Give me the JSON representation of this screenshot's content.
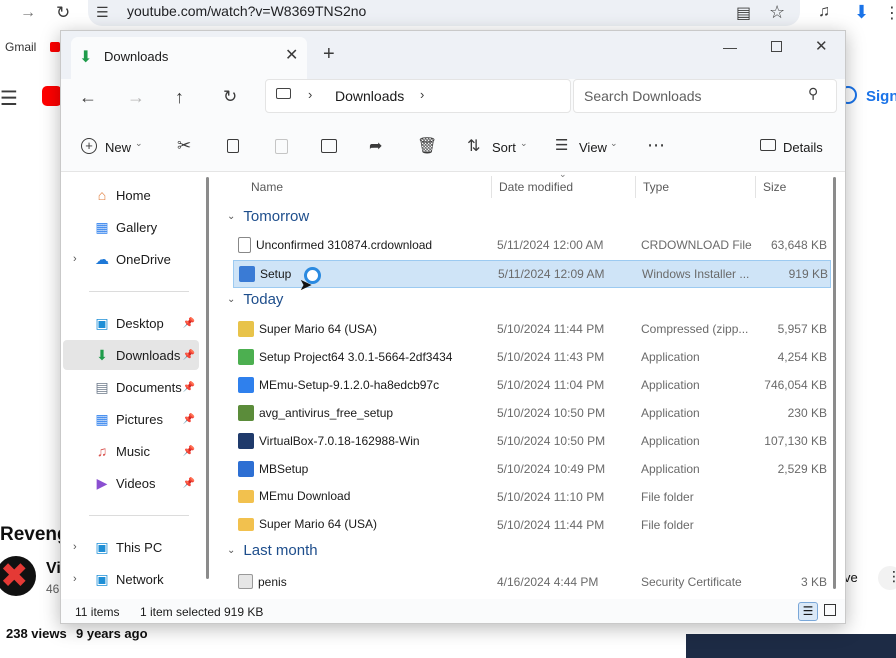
{
  "browser": {
    "url": "youtube.com/watch?v=W8369TNS2no",
    "bookmark_gmail": "Gmail",
    "sign_in": "Sign",
    "video_title_fragment": "Reveng",
    "channel_fragment": "Vi",
    "subs_fragment": "46",
    "views": "238 views",
    "age": "9 years ago",
    "save_fragment": "ve"
  },
  "explorer": {
    "tab_title": "Downloads",
    "address_crumb": "Downloads",
    "search_placeholder": "Search Downloads",
    "toolbar": {
      "new": "New",
      "sort": "Sort",
      "view": "View",
      "details": "Details"
    },
    "sidebar": [
      {
        "label": "Home",
        "icon": "home-icon"
      },
      {
        "label": "Gallery",
        "icon": "gallery-icon"
      },
      {
        "label": "OneDrive",
        "icon": "cloud-icon"
      },
      {
        "label": "Desktop",
        "icon": "desktop-icon"
      },
      {
        "label": "Downloads",
        "icon": "download-icon"
      },
      {
        "label": "Documents",
        "icon": "documents-icon"
      },
      {
        "label": "Pictures",
        "icon": "pictures-icon"
      },
      {
        "label": "Music",
        "icon": "music-icon"
      },
      {
        "label": "Videos",
        "icon": "videos-icon"
      },
      {
        "label": "This PC",
        "icon": "pc-icon"
      },
      {
        "label": "Network",
        "icon": "network-icon"
      }
    ],
    "columns": {
      "name": "Name",
      "date": "Date modified",
      "type": "Type",
      "size": "Size"
    },
    "groups": {
      "tomorrow": "Tomorrow",
      "today": "Today",
      "last_month": "Last month"
    },
    "files_tomorrow": [
      {
        "name": "Unconfirmed 310874.crdownload",
        "date": "5/11/2024 12:00 AM",
        "type": "CRDOWNLOAD File",
        "size": "63,648 KB",
        "color": "#ffffff"
      },
      {
        "name": "Setup",
        "date": "5/11/2024 12:09 AM",
        "type": "Windows Installer ...",
        "size": "919 KB",
        "color": "#3a7bd5"
      }
    ],
    "files_today": [
      {
        "name": "Super Mario 64 (USA)",
        "date": "5/10/2024 11:44 PM",
        "type": "Compressed (zipp...",
        "size": "5,957 KB",
        "color": "#e8c34a"
      },
      {
        "name": "Setup Project64 3.0.1-5664-2df3434",
        "date": "5/10/2024 11:43 PM",
        "type": "Application",
        "size": "4,254 KB",
        "color": "#4caf50"
      },
      {
        "name": "MEmu-Setup-9.1.2.0-ha8edcb97c",
        "date": "5/10/2024 11:04 PM",
        "type": "Application",
        "size": "746,054 KB",
        "color": "#2f80ed"
      },
      {
        "name": "avg_antivirus_free_setup",
        "date": "5/10/2024 10:50 PM",
        "type": "Application",
        "size": "230 KB",
        "color": "#5b8c3a"
      },
      {
        "name": "VirtualBox-7.0.18-162988-Win",
        "date": "5/10/2024 10:50 PM",
        "type": "Application",
        "size": "107,130 KB",
        "color": "#1f3a6b"
      },
      {
        "name": "MBSetup",
        "date": "5/10/2024 10:49 PM",
        "type": "Application",
        "size": "2,529 KB",
        "color": "#2d6fd3"
      },
      {
        "name": "MEmu Download",
        "date": "5/10/2024 11:10 PM",
        "type": "File folder",
        "size": "",
        "color": "#f2c14e"
      },
      {
        "name": "Super Mario 64 (USA)",
        "date": "5/10/2024 11:44 PM",
        "type": "File folder",
        "size": "",
        "color": "#f2c14e"
      }
    ],
    "files_last_month": [
      {
        "name": "penis",
        "date": "4/16/2024 4:44 PM",
        "type": "Security Certificate",
        "size": "3 KB",
        "color": "#e6e6e6"
      }
    ],
    "status": {
      "items": "11 items",
      "selected": "1 item selected",
      "size": "919 KB"
    }
  }
}
